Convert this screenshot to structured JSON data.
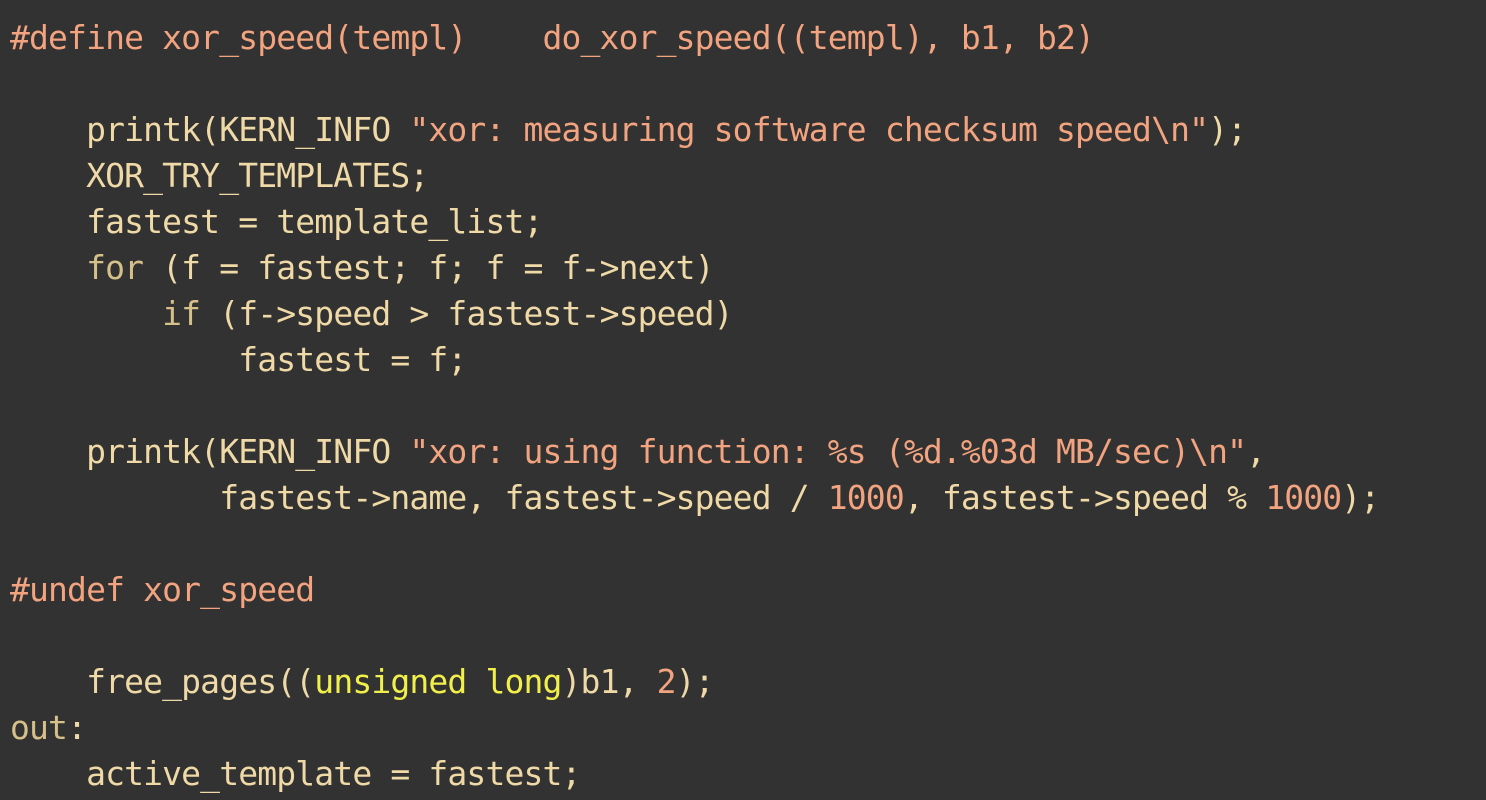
{
  "colors": {
    "background": "#323232",
    "default": "#efd9a6",
    "preprocessor": "#f2a37f",
    "string": "#f2a37f",
    "number": "#f2a37f",
    "keyword": "#d6c08a",
    "type": "#f1f04b",
    "label": "#d6c08a"
  },
  "code": {
    "lines": [
      [
        {
          "t": "pre",
          "v": "#define xor_speed(templ)    do_xor_speed((templ), b1, b2)"
        }
      ],
      [],
      [
        {
          "t": "default",
          "v": "    printk(KERN_INFO "
        },
        {
          "t": "str",
          "v": "\"xor: measuring software checksum speed\\n\""
        },
        {
          "t": "default",
          "v": ");"
        }
      ],
      [
        {
          "t": "default",
          "v": "    XOR_TRY_TEMPLATES;"
        }
      ],
      [
        {
          "t": "default",
          "v": "    fastest = template_list;"
        }
      ],
      [
        {
          "t": "default",
          "v": "    "
        },
        {
          "t": "kw",
          "v": "for"
        },
        {
          "t": "default",
          "v": " (f = fastest; f; f = f->next)"
        }
      ],
      [
        {
          "t": "default",
          "v": "        "
        },
        {
          "t": "kw",
          "v": "if"
        },
        {
          "t": "default",
          "v": " (f->speed > fastest->speed)"
        }
      ],
      [
        {
          "t": "default",
          "v": "            fastest = f;"
        }
      ],
      [],
      [
        {
          "t": "default",
          "v": "    printk(KERN_INFO "
        },
        {
          "t": "str",
          "v": "\"xor: using function: %s (%d.%03d MB/sec)\\n\""
        },
        {
          "t": "default",
          "v": ","
        }
      ],
      [
        {
          "t": "default",
          "v": "           fastest->name, fastest->speed / "
        },
        {
          "t": "num",
          "v": "1000"
        },
        {
          "t": "default",
          "v": ", fastest->speed % "
        },
        {
          "t": "num",
          "v": "1000"
        },
        {
          "t": "default",
          "v": ");"
        }
      ],
      [],
      [
        {
          "t": "pre",
          "v": "#undef xor_speed"
        }
      ],
      [],
      [
        {
          "t": "default",
          "v": "    free_pages(("
        },
        {
          "t": "type",
          "v": "unsigned long"
        },
        {
          "t": "default",
          "v": ")b1, "
        },
        {
          "t": "num",
          "v": "2"
        },
        {
          "t": "default",
          "v": ");"
        }
      ],
      [
        {
          "t": "label",
          "v": "out"
        },
        {
          "t": "default",
          "v": ":"
        }
      ],
      [
        {
          "t": "default",
          "v": "    active_template = fastest;"
        }
      ]
    ]
  }
}
